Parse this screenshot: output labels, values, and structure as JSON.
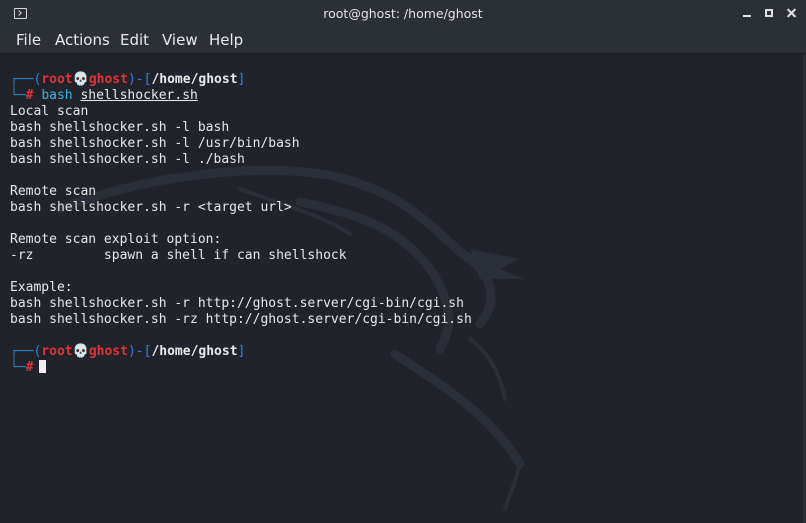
{
  "window": {
    "title": "root@ghost: /home/ghost"
  },
  "menu": [
    "File",
    "Actions",
    "Edit",
    "View",
    "Help"
  ],
  "prompt": {
    "user": "root",
    "skull": "💀",
    "host": "ghost",
    "path": "/home/ghost",
    "symbol": "#"
  },
  "command": {
    "program": "bash",
    "argument": "shellshocker.sh"
  },
  "output": [
    "Local scan",
    "bash shellshocker.sh -l bash",
    "bash shellshocker.sh -l /usr/bin/bash",
    "bash shellshocker.sh -l ./bash",
    "",
    "Remote scan",
    "bash shellshocker.sh -r <target url>",
    "",
    "Remote scan exploit option:",
    "-rz         spawn a shell if can shellshock",
    "",
    "Example:",
    "bash shellshocker.sh -r http://ghost.server/cgi-bin/cgi.sh",
    "bash shellshocker.sh -rz http://ghost.server/cgi-bin/cgi.sh",
    ""
  ]
}
